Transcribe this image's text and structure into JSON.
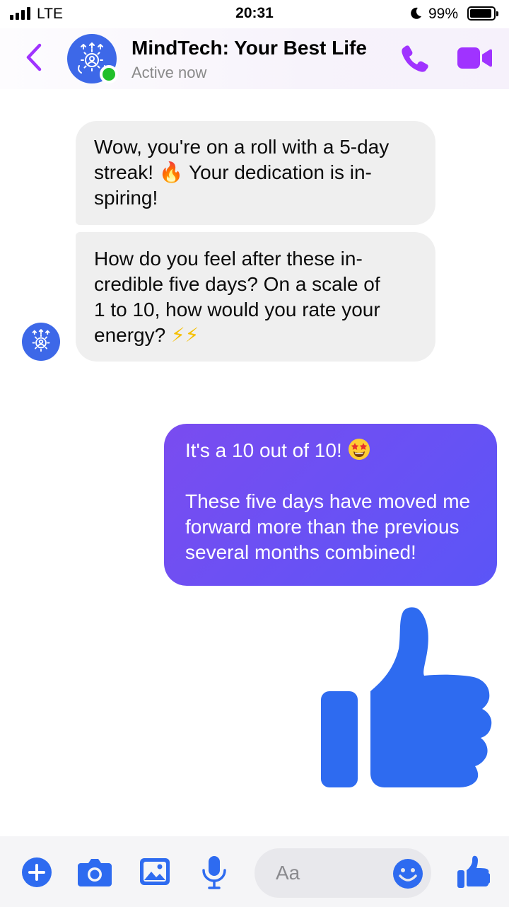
{
  "status_bar": {
    "carrier": "LTE",
    "time": "20:31",
    "battery": "99%"
  },
  "header": {
    "title": "MindTech: Your Best Life",
    "status": "Active now"
  },
  "messages": [
    {
      "from": "bot",
      "lines": [
        "Wow, you're on a roll with a 5-day",
        "streak!",
        "Your dedication is in-",
        "spiring!"
      ],
      "emoji": "🔥"
    },
    {
      "from": "bot",
      "lines": [
        "How do you feel after these in-",
        "credible five days? On a scale of",
        "1 to 10, how would you rate your",
        "energy?"
      ],
      "emoji": "⚡⚡"
    },
    {
      "from": "user",
      "lines": [
        "It's a 10 out of 10!",
        "These five days have moved me",
        "forward more than the previous",
        "several months combined!"
      ]
    }
  ],
  "composer": {
    "placeholder": "Aa"
  },
  "colors": {
    "accent": "#a033ff",
    "messenger_blue": "#2e6bf0",
    "outgoing_bubble": "#6a4ff4",
    "incoming_bubble": "#efefef",
    "online": "#22c02a"
  },
  "icons": [
    "back-arrow-icon",
    "phone-icon",
    "video-camera-icon",
    "plus-icon",
    "camera-icon",
    "gallery-icon",
    "microphone-icon",
    "smiley-icon",
    "thumbs-up-icon"
  ]
}
